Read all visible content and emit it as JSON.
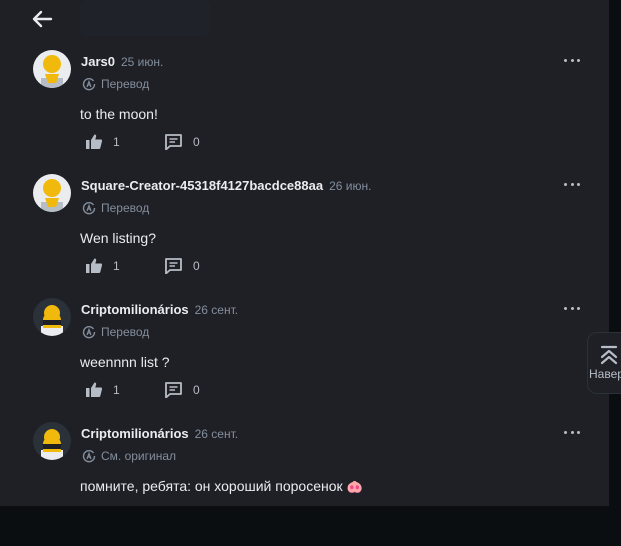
{
  "nav": {
    "back_icon": "arrow-left-icon"
  },
  "comments": [
    {
      "author": "Jars0",
      "date": "25 июн.",
      "translate_label": "Перевод",
      "text": "to the moon!",
      "likes": "1",
      "replies": "0",
      "avatar": "default-avatar-light"
    },
    {
      "author": "Square-Creator-45318f4127bacdce88aa",
      "date": "26 июн.",
      "translate_label": "Перевод",
      "text": "Wen listing?",
      "likes": "1",
      "replies": "0",
      "avatar": "default-avatar-light"
    },
    {
      "author": "Criptomilionários",
      "date": "26 сент.",
      "translate_label": "Перевод",
      "text": "weennnn list ?",
      "likes": "1",
      "replies": "0",
      "avatar": "default-avatar-dark"
    },
    {
      "author": "Criptomilionários",
      "date": "26 сент.",
      "translate_label": "См. оригинал",
      "text": "помните, ребята: он хороший поросенок",
      "emoji": "🐽",
      "avatar": "default-avatar-dark"
    }
  ],
  "scroll_top": {
    "label": "Навер",
    "icon": "chevrons-up-icon"
  },
  "colors": {
    "background": "#1e2026",
    "text_primary": "#eaecef",
    "text_secondary": "#848e9c",
    "avatar_yellow": "#f0b90b"
  }
}
